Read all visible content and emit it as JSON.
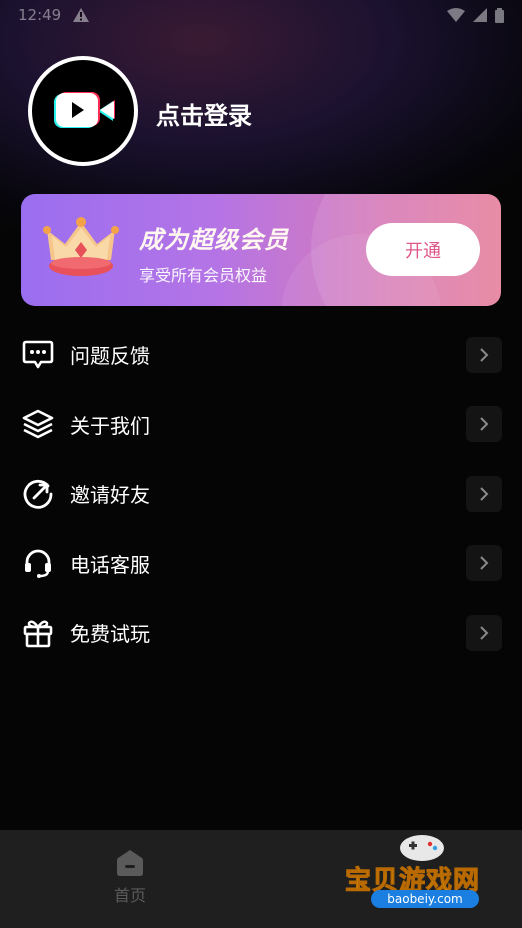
{
  "status_bar": {
    "time": "12:49"
  },
  "profile": {
    "login_text": "点击登录"
  },
  "vip": {
    "title": "成为超级会员",
    "subtitle": "享受所有会员权益",
    "button": "开通"
  },
  "menu": [
    {
      "label": "问题反馈",
      "icon": "feedback-icon"
    },
    {
      "label": "关于我们",
      "icon": "layers-icon"
    },
    {
      "label": "邀请好友",
      "icon": "invite-icon"
    },
    {
      "label": "电话客服",
      "icon": "headset-icon"
    },
    {
      "label": "免费试玩",
      "icon": "gift-icon"
    }
  ],
  "bottom_nav": {
    "home_label": "首页"
  },
  "watermark": {
    "title": "宝贝游戏网",
    "url": "baobeiy.com"
  },
  "colors": {
    "vip_start": "#9a6ef0",
    "vip_end": "#e67f9c",
    "button_text": "#e0578a"
  }
}
